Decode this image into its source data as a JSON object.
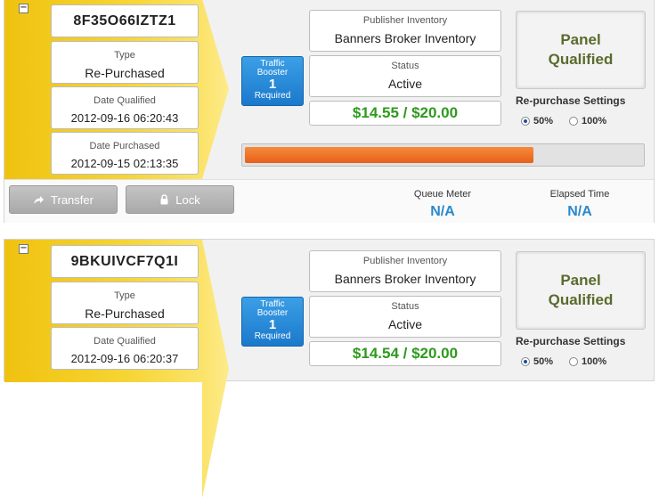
{
  "entries": [
    {
      "code": "8F35O66IZTZ1",
      "type_label": "Type",
      "type_value": "Re-Purchased",
      "date_qualified_label": "Date Qualified",
      "date_qualified": "2012-09-16 06:20:43",
      "date_purchased_label": "Date Purchased",
      "date_purchased": "2012-09-15 02:13:35",
      "booster": {
        "line1": "Traffic",
        "line2": "Booster",
        "count": "1",
        "line3": "Required"
      },
      "publisher_label": "Publisher Inventory",
      "publisher_value": "Banners Broker Inventory",
      "status_label": "Status",
      "status_value": "Active",
      "amount": "$14.55 / $20.00",
      "qualified_line1": "Panel",
      "qualified_line2": "Qualified",
      "repurchase_title": "Re-purchase Settings",
      "options": [
        "50%",
        "100%"
      ],
      "selected_option": "50%",
      "progress_fraction": 0.727,
      "transfer_label": "Transfer",
      "lock_label": "Lock",
      "queue_meter_label": "Queue Meter",
      "queue_meter_value": "N/A",
      "elapsed_time_label": "Elapsed Time",
      "elapsed_time_value": "N/A"
    },
    {
      "code": "9BKUIVCF7Q1I",
      "type_label": "Type",
      "type_value": "Re-Purchased",
      "date_qualified_label": "Date Qualified",
      "date_qualified": "2012-09-16 06:20:37",
      "booster": {
        "line1": "Traffic",
        "line2": "Booster",
        "count": "1",
        "line3": "Required"
      },
      "publisher_label": "Publisher Inventory",
      "publisher_value": "Banners Broker Inventory",
      "status_label": "Status",
      "status_value": "Active",
      "amount": "$14.54 / $20.00",
      "qualified_line1": "Panel",
      "qualified_line2": "Qualified",
      "repurchase_title": "Re-purchase Settings",
      "options": [
        "50%",
        "100%"
      ],
      "selected_option": "50%"
    }
  ],
  "colors": {
    "gold": "#f0c20f",
    "booster_blue": "#1b79cc",
    "money_green": "#2e9a1d",
    "progress_orange": "#e8601a",
    "meter_blue": "#2a89cc"
  },
  "icons": {
    "collapse": "minus-icon",
    "transfer": "share-arrow-icon",
    "lock": "lock-icon"
  }
}
